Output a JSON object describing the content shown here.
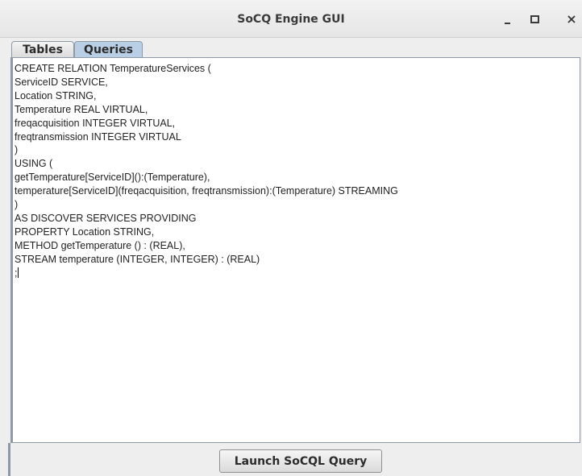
{
  "window": {
    "title": "SoCQ Engine GUI",
    "controls": {
      "minimize": "minimize-icon",
      "maximize": "maximize-icon",
      "close": "close-icon",
      "close_glyph": "×"
    }
  },
  "tabs": [
    {
      "label": "Tables",
      "selected": false
    },
    {
      "label": "Queries",
      "selected": true
    }
  ],
  "editor": {
    "lines": [
      "CREATE RELATION TemperatureServices (",
      "ServiceID SERVICE,",
      "Location STRING,",
      "Temperature REAL VIRTUAL,",
      "freqacquisition INTEGER VIRTUAL,",
      "freqtransmission INTEGER VIRTUAL",
      ")",
      "USING (",
      "getTemperature[ServiceID]():(Temperature),",
      "temperature[ServiceID](freqacquisition, freqtransmission):(Temperature) STREAMING",
      ")",
      "AS DISCOVER SERVICES PROVIDING",
      "PROPERTY Location STRING,",
      "METHOD getTemperature () : (REAL),",
      "STREAM temperature (INTEGER, INTEGER) : (REAL)",
      ";"
    ]
  },
  "launch_button": {
    "label": "Launch SoCQL Query"
  },
  "colors": {
    "selected_tab": "#b8cfe5",
    "window_bg": "#eeeeee",
    "border": "#8e99a6"
  }
}
